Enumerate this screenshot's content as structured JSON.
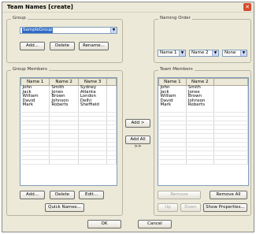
{
  "window": {
    "title": "Team Names [create]"
  },
  "group": {
    "label": "Group",
    "selected": "SampleGroup",
    "buttons": {
      "add": "Add...",
      "delete": "Delete",
      "rename": "Rename..."
    }
  },
  "naming_order": {
    "label": "Naming Order",
    "selects": [
      "Name 1",
      "Name 2",
      "None"
    ]
  },
  "group_members": {
    "label": "Group Members",
    "columns": [
      "Name 1",
      "Name 2",
      "Name 3"
    ],
    "rows": [
      [
        "John",
        "Smith",
        "Sydney"
      ],
      [
        "Jack",
        "Jones",
        "Atlanta"
      ],
      [
        "William",
        "Brown",
        "London"
      ],
      [
        "David",
        "Johnson",
        "Delhi"
      ],
      [
        "Mark",
        "Roberts",
        "Sheffield"
      ]
    ],
    "buttons": {
      "add": "Add...",
      "delete": "Delete",
      "edit": "Edit...",
      "quick_names": "Quick Names..."
    }
  },
  "middle": {
    "add": "Add >",
    "add_all": "Add All >>"
  },
  "team_members": {
    "label": "Team Members",
    "columns": [
      "Name 1",
      "Name 2"
    ],
    "rows": [
      [
        "John",
        "Smith"
      ],
      [
        "Jack",
        "Jones"
      ],
      [
        "William",
        "Brown"
      ],
      [
        "David",
        "Johnson"
      ],
      [
        "Mark",
        "Roberts"
      ]
    ],
    "buttons": {
      "remove": "Remove",
      "remove_all": "Remove All",
      "up": "Up",
      "down": "Down",
      "show_properties": "Show Properties..."
    }
  },
  "footer": {
    "ok": "OK",
    "cancel": "Cancel"
  }
}
